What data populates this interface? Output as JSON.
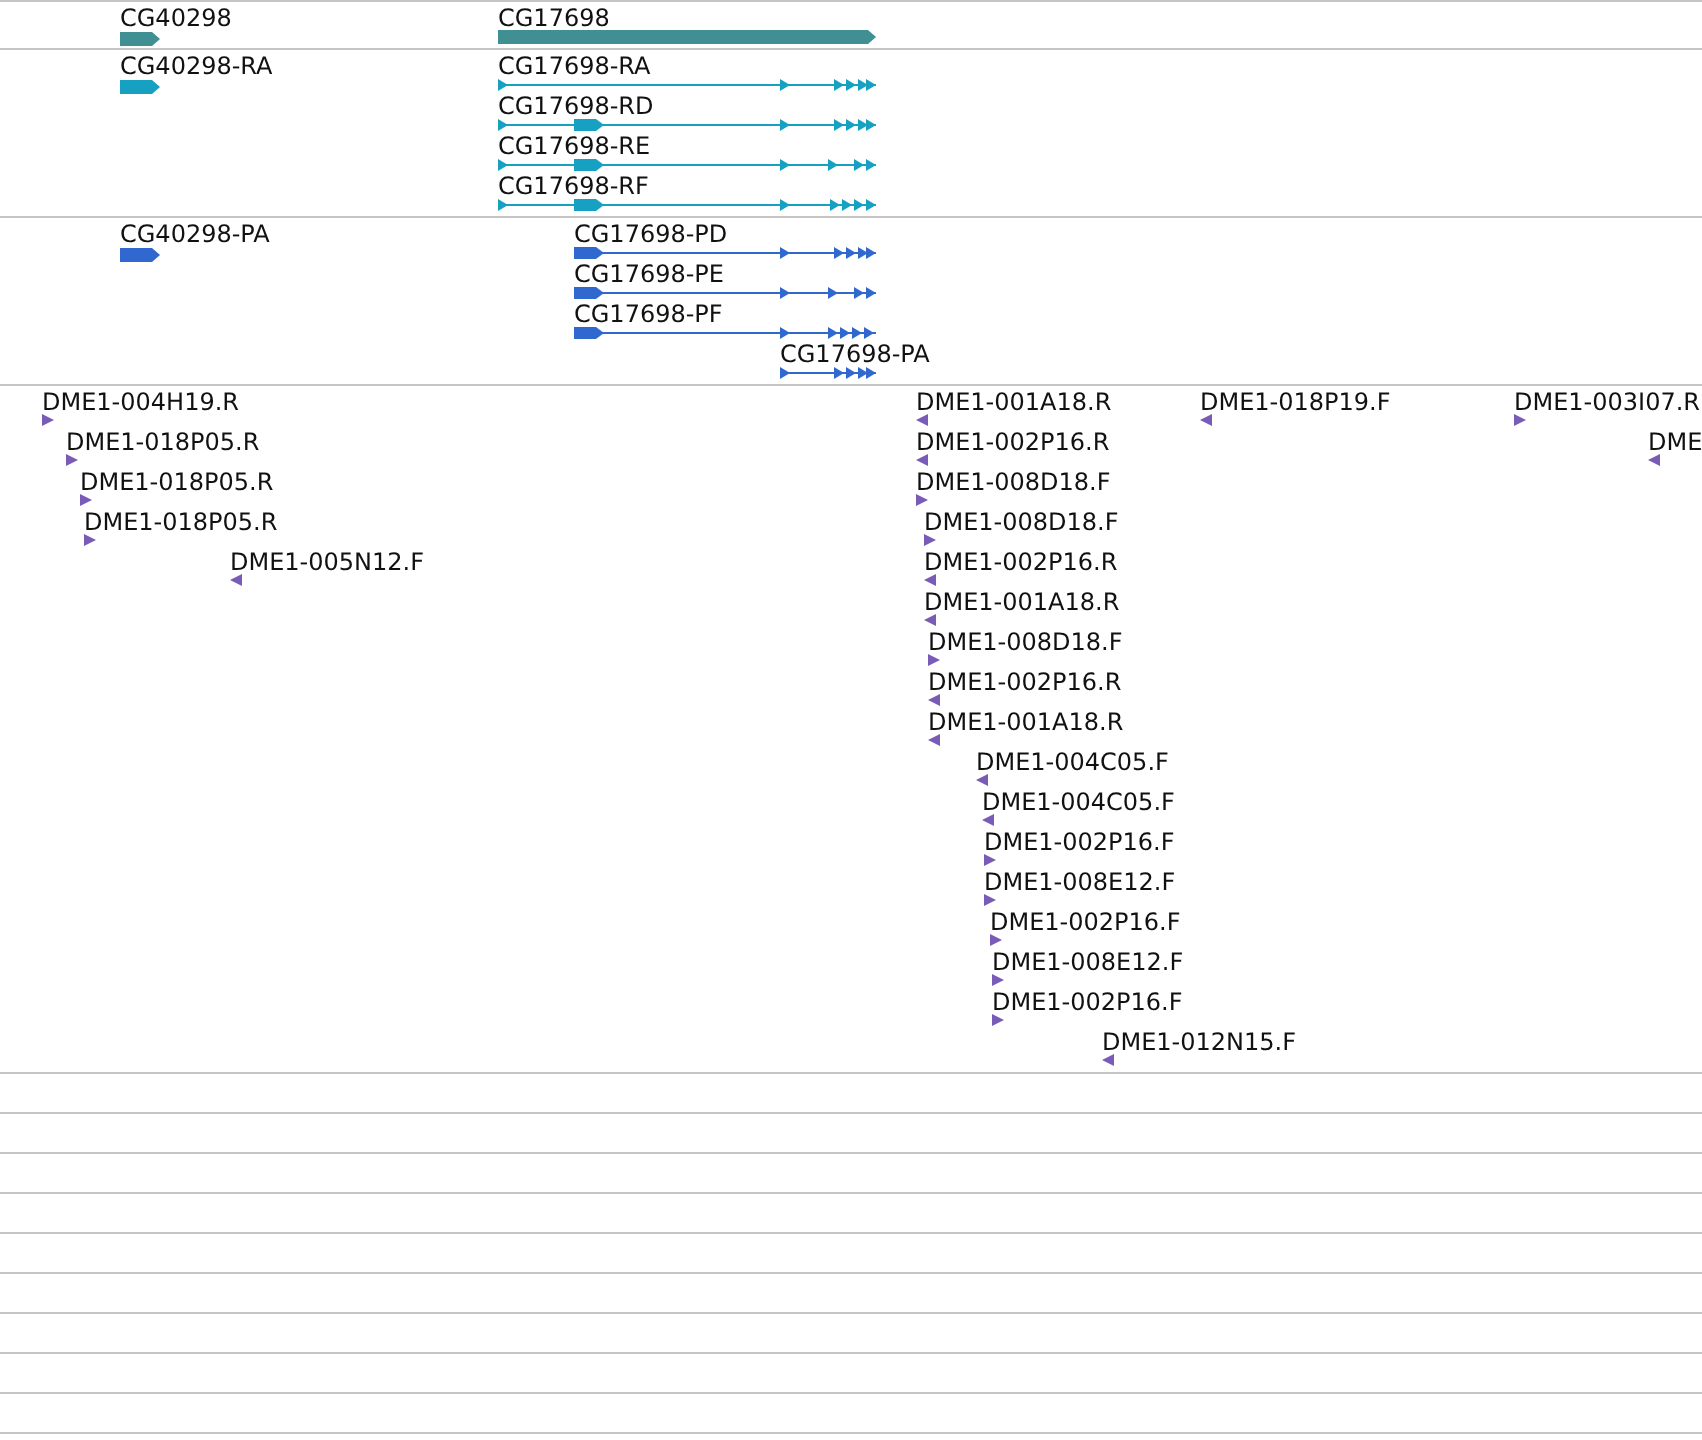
{
  "tracks": [
    {
      "kind": "genes",
      "color": "#3f8f93",
      "features": [
        {
          "label": "CG40298"
        },
        {
          "label": "CG17698"
        }
      ]
    },
    {
      "kind": "transcripts",
      "color": "#16a0c2",
      "features": [
        {
          "label": "CG40298-RA"
        },
        {
          "label": "CG17698-RA"
        },
        {
          "label": "CG17698-RD"
        },
        {
          "label": "CG17698-RE"
        },
        {
          "label": "CG17698-RF"
        }
      ]
    },
    {
      "kind": "proteins",
      "color": "#3168cf",
      "features": [
        {
          "label": "CG40298-PA"
        },
        {
          "label": "CG17698-PD"
        },
        {
          "label": "CG17698-PE"
        },
        {
          "label": "CG17698-PF"
        },
        {
          "label": "CG17698-PA"
        }
      ]
    },
    {
      "kind": "ests",
      "color": "#7a5cb8",
      "features": [
        {
          "label": "DME1-004H19.R",
          "reverse": false
        },
        {
          "label": "DME1-001A18.R",
          "reverse": true
        },
        {
          "label": "DME1-018P19.F",
          "reverse": true
        },
        {
          "label": "DME1-003I07.R",
          "reverse": false
        },
        {
          "label": "DME1-018P05.R",
          "reverse": false
        },
        {
          "label": "DME1-002P16.R",
          "reverse": true
        },
        {
          "label": "DME",
          "reverse": true
        },
        {
          "label": "DME1-018P05.R",
          "reverse": false
        },
        {
          "label": "DME1-008D18.F",
          "reverse": false
        },
        {
          "label": "DME1-018P05.R",
          "reverse": false
        },
        {
          "label": "DME1-008D18.F",
          "reverse": false
        },
        {
          "label": "DME1-005N12.F",
          "reverse": true
        },
        {
          "label": "DME1-002P16.R",
          "reverse": true
        },
        {
          "label": "DME1-001A18.R",
          "reverse": true
        },
        {
          "label": "DME1-008D18.F",
          "reverse": false
        },
        {
          "label": "DME1-002P16.R",
          "reverse": true
        },
        {
          "label": "DME1-001A18.R",
          "reverse": true
        },
        {
          "label": "DME1-004C05.F",
          "reverse": true
        },
        {
          "label": "DME1-004C05.F",
          "reverse": true
        },
        {
          "label": "DME1-002P16.F",
          "reverse": false
        },
        {
          "label": "DME1-008E12.F",
          "reverse": false
        },
        {
          "label": "DME1-002P16.F",
          "reverse": false
        },
        {
          "label": "DME1-008E12.F",
          "reverse": false
        },
        {
          "label": "DME1-002P16.F",
          "reverse": false
        },
        {
          "label": "DME1-012N15.F",
          "reverse": true
        }
      ]
    }
  ]
}
